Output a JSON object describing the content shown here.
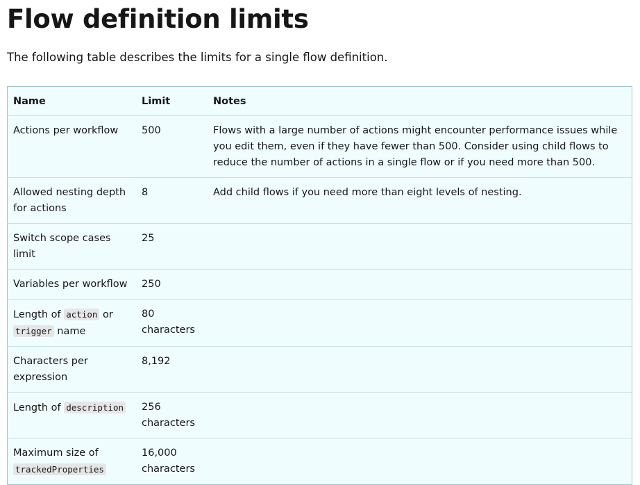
{
  "heading": "Flow definition limits",
  "intro": "The following table describes the limits for a single flow definition.",
  "table": {
    "headers": {
      "name": "Name",
      "limit": "Limit",
      "notes": "Notes"
    },
    "rows": [
      {
        "name": "Actions per workflow",
        "limit": "500",
        "notes": "Flows with a large number of actions might encounter performance issues while you edit them, even if they have fewer than 500. Consider using child flows to reduce the number of actions in a single flow or if you need more than 500."
      },
      {
        "name": "Allowed nesting depth for actions",
        "limit": "8",
        "notes": "Add child flows if you need more than eight levels of nesting."
      },
      {
        "name": "Switch scope cases limit",
        "limit": "25",
        "notes": ""
      },
      {
        "name": "Variables per workflow",
        "limit": "250",
        "notes": ""
      },
      {
        "name_parts": {
          "prefix": "Length of ",
          "code1": "action",
          "middle": " or ",
          "code2": "trigger",
          "suffix": " name"
        },
        "limit": "80 characters",
        "notes": ""
      },
      {
        "name": "Characters per expression",
        "limit": "8,192",
        "notes": ""
      },
      {
        "name_parts": {
          "prefix": "Length of ",
          "code1": "description"
        },
        "limit": "256 characters",
        "notes": ""
      },
      {
        "name_parts": {
          "prefix": "Maximum size of ",
          "code1": "trackedProperties"
        },
        "limit": "16,000 characters",
        "notes": ""
      }
    ]
  }
}
